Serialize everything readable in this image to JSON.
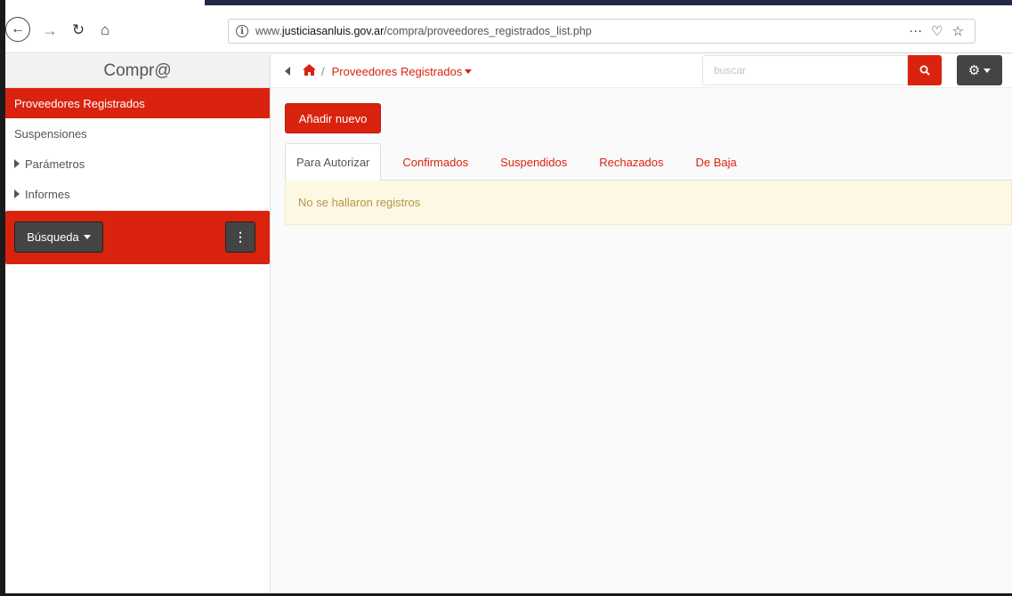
{
  "browser": {
    "url_prefix": "www.",
    "url_domain": "justiciasanluis.gov.ar",
    "url_path": "/compra/proveedores_registrados_list.php",
    "icons": [
      "back-arrow-icon",
      "forward-arrow-icon",
      "reload-icon",
      "home-icon",
      "info-icon",
      "more-icon",
      "pocket-icon",
      "star-icon"
    ]
  },
  "sidebar": {
    "title": "Compr@",
    "items": [
      {
        "label": "Proveedores Registrados",
        "active": true
      },
      {
        "label": "Suspensiones"
      },
      {
        "label": "Parámetros",
        "expandable": true
      },
      {
        "label": "Informes",
        "expandable": true
      }
    ],
    "search_button_label": "Búsqueda"
  },
  "main": {
    "breadcrumb": {
      "separator": "/",
      "current": "Proveedores Registrados"
    },
    "search": {
      "placeholder": "buscar"
    },
    "add_button_label": "Añadir nuevo",
    "tabs": [
      {
        "label": "Para Autorizar",
        "active": true
      },
      {
        "label": "Confirmados"
      },
      {
        "label": "Suspendidos"
      },
      {
        "label": "Rechazados"
      },
      {
        "label": "De Baja"
      }
    ],
    "empty_message": "No se hallaron registros"
  },
  "colors": {
    "accent": "#d9230f",
    "dark_button": "#444444",
    "alert_bg": "#fcf8e3",
    "alert_text": "#b99549"
  }
}
